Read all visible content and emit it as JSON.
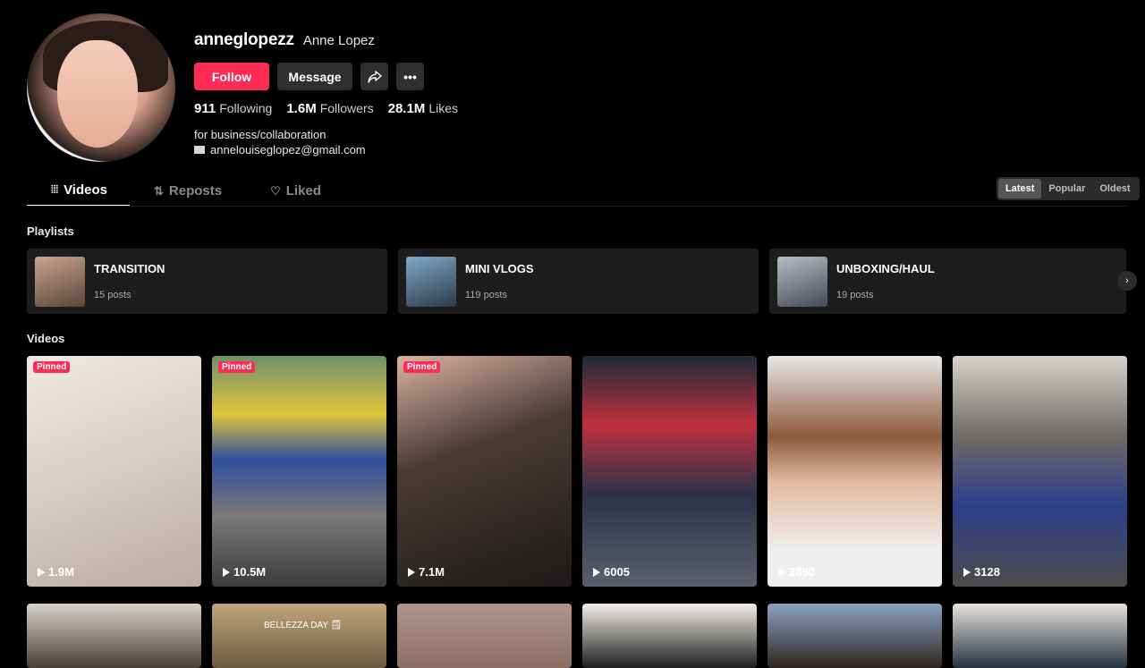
{
  "profile": {
    "username": "anneglopezz",
    "display_name": "Anne Lopez",
    "follow_label": "Follow",
    "message_label": "Message",
    "share_icon": "share-icon",
    "more_icon": "more-icon",
    "stats": [
      {
        "value": "911",
        "label": "Following"
      },
      {
        "value": "1.6M",
        "label": "Followers"
      },
      {
        "value": "28.1M",
        "label": "Likes"
      }
    ],
    "bio_line1": "for business/collaboration",
    "bio_email": "annelouiseglopez@gmail.com"
  },
  "tabs": [
    {
      "label": "Videos",
      "icon": "grid-icon",
      "active": true
    },
    {
      "label": "Reposts",
      "icon": "repost-icon",
      "active": false
    },
    {
      "label": "Liked",
      "icon": "heart-icon",
      "active": false
    }
  ],
  "sort": [
    "Latest",
    "Popular",
    "Oldest"
  ],
  "playlists_title": "Playlists",
  "playlists": [
    {
      "title": "TRANSITION",
      "count": "15 posts",
      "color": "#8a6a5a"
    },
    {
      "title": "MINI VLOGS",
      "count": "119 posts",
      "color": "#3f6b8f"
    },
    {
      "title": "UNBOXING/HAUL",
      "count": "19 posts",
      "color": "#6b6b6b"
    }
  ],
  "videos_title": "Videos",
  "videos_row1": [
    {
      "views": "1.9M",
      "pinned": "Pinned",
      "bg": "linear-gradient(160deg,#efe9e4 0%,#d9cfc7 45%,#b9aca2 100%)"
    },
    {
      "views": "10.5M",
      "pinned": "Pinned",
      "bg": "linear-gradient(180deg,#6f8f6a 0%,#e0c53a 25%,#2f4f9a 45%,#7b7a78 70%,#3b3b3b 100%)"
    },
    {
      "views": "7.1M",
      "pinned": "Pinned",
      "bg": "linear-gradient(160deg,#d9b39f 0%,#4a3b35 40%,#1c1a19 100%)"
    },
    {
      "views": "6005",
      "pinned": "",
      "bg": "linear-gradient(180deg,#1e2a3a 0%,#c03040 30%,#2a3348 60%,#5a5f6b 100%)"
    },
    {
      "views": "2850",
      "pinned": "",
      "bg": "linear-gradient(180deg,#e8e8e8 0%,#8d5a3d 35%,#e4bba3 55%,#efefef 85%)"
    },
    {
      "views": "3128",
      "pinned": "",
      "bg": "linear-gradient(180deg,#d8d2cb 0%,#6f6a66 35%,#2c3f8a 65%,#4e4b4a 100%)"
    }
  ],
  "videos_row2": [
    {
      "bg": "linear-gradient(180deg,#d9d2c7,#4a3f36)"
    },
    {
      "bg": "linear-gradient(180deg,#c1a57a,#6d5a43)",
      "caption": "BELLEZZA DAY 🗒"
    },
    {
      "bg": "linear-gradient(180deg,#b0958b,#8b6f63)"
    },
    {
      "bg": "linear-gradient(180deg,#f3efe9,#1d1d1d)"
    },
    {
      "bg": "linear-gradient(180deg,#8ba2c0,#2f2620)"
    },
    {
      "bg": "linear-gradient(180deg,#e9e3db,#25323f)"
    }
  ]
}
